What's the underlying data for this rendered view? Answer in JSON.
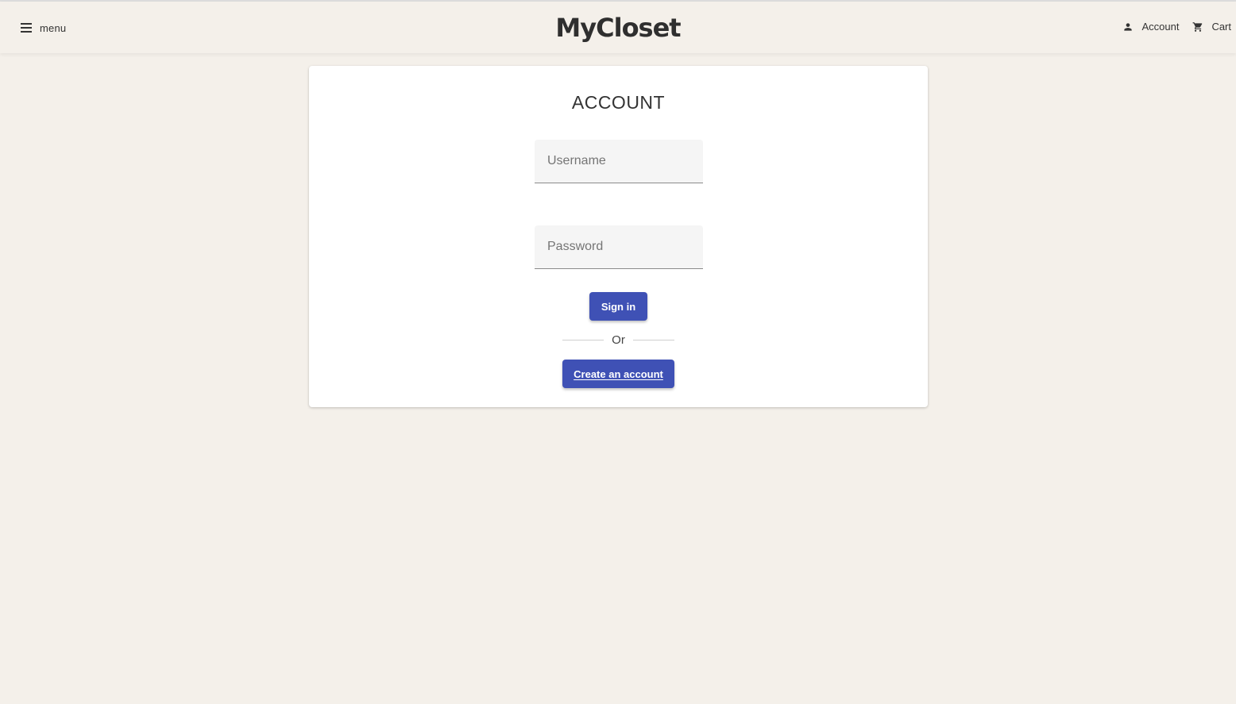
{
  "header": {
    "menu_label": "menu",
    "logo_text": "MyCloset",
    "account_label": "Account",
    "cart_label": "Cart"
  },
  "login": {
    "title": "ACCOUNT",
    "username_placeholder": "Username",
    "username_value": "",
    "password_placeholder": "Password",
    "password_value": "",
    "signin_label": "Sign in",
    "divider_text": "Or",
    "create_label": "Create an account"
  },
  "colors": {
    "background": "#f4f0ea",
    "card": "#ffffff",
    "primary": "#3f51b5",
    "input_fill": "#f5f5f5"
  },
  "icons": {
    "menu": "menu-icon",
    "account": "person-icon",
    "cart": "cart-icon"
  }
}
